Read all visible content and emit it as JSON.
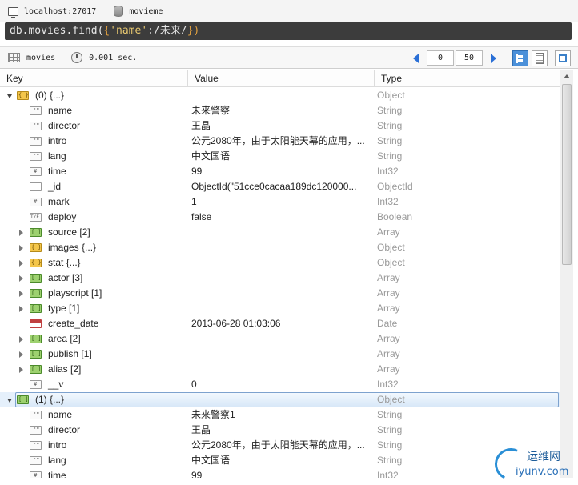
{
  "connection": {
    "host": "localhost:27017",
    "database": "movieme"
  },
  "query": {
    "prefix": "db.movies.find(",
    "open_brace": "{",
    "key": "'name'",
    "colon": ":",
    "pattern": "/未来/",
    "close": "})"
  },
  "toolbar": {
    "collection": "movies",
    "time": "0.001 sec.",
    "skip": "0",
    "limit": "50"
  },
  "columns": {
    "key": "Key",
    "value": "Value",
    "type": "Type"
  },
  "rows": [
    {
      "key": "(0)  {...}",
      "value": "",
      "type": "Object"
    },
    {
      "key": "name",
      "value": "未来警察",
      "type": "String"
    },
    {
      "key": "director",
      "value": "王晶",
      "type": "String"
    },
    {
      "key": "intro",
      "value": "公元2080年，由于太阳能天幕的应用，...",
      "type": "String"
    },
    {
      "key": "lang",
      "value": "中文国语",
      "type": "String"
    },
    {
      "key": "time",
      "value": "99",
      "type": "Int32"
    },
    {
      "key": "_id",
      "value": "ObjectId(\"51cce0cacaa189dc120000...",
      "type": "ObjectId"
    },
    {
      "key": "mark",
      "value": "1",
      "type": "Int32"
    },
    {
      "key": "deploy",
      "value": "false",
      "type": "Boolean"
    },
    {
      "key": "source [2]",
      "value": "",
      "type": "Array"
    },
    {
      "key": "images  {...}",
      "value": "",
      "type": "Object"
    },
    {
      "key": "stat  {...}",
      "value": "",
      "type": "Object"
    },
    {
      "key": "actor [3]",
      "value": "",
      "type": "Array"
    },
    {
      "key": "playscript [1]",
      "value": "",
      "type": "Array"
    },
    {
      "key": "type [1]",
      "value": "",
      "type": "Array"
    },
    {
      "key": "create_date",
      "value": "2013-06-28 01:03:06",
      "type": "Date"
    },
    {
      "key": "area [2]",
      "value": "",
      "type": "Array"
    },
    {
      "key": "publish [1]",
      "value": "",
      "type": "Array"
    },
    {
      "key": "alias [2]",
      "value": "",
      "type": "Array"
    },
    {
      "key": "__v",
      "value": "0",
      "type": "Int32"
    },
    {
      "key": "(1)  {...}",
      "value": "",
      "type": "Object"
    },
    {
      "key": "name",
      "value": "未来警察1",
      "type": "String"
    },
    {
      "key": "director",
      "value": "王晶",
      "type": "String"
    },
    {
      "key": "intro",
      "value": "公元2080年，由于太阳能天幕的应用，...",
      "type": "String"
    },
    {
      "key": "lang",
      "value": "中文国语",
      "type": "String"
    },
    {
      "key": "time",
      "value": "99",
      "type": "Int32"
    }
  ],
  "watermark": {
    "cn": "运维网",
    "en": "iyunv.com"
  }
}
